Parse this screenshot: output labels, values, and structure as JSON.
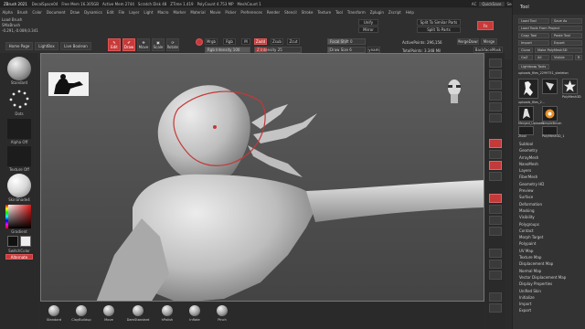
{
  "menubar": {
    "app_title": "ZBrush 2021",
    "stats": [
      "DecalSpace04",
      "Free Mem 16.305GB",
      "Active Mem 2744",
      "Scratch Disk 48",
      "ZTime 1.419",
      "Timer 0.001",
      "ATime 0.012",
      "PolyCount 4.753 MP",
      "MeshCount 1"
    ],
    "menus": [
      "Alpha",
      "Brush",
      "Color",
      "Document",
      "Draw",
      "Dynamics",
      "Edit",
      "File",
      "Layer",
      "Light",
      "Macro",
      "Marker",
      "Material",
      "Movie",
      "Picker",
      "Preferences",
      "Render",
      "Stencil",
      "Stroke",
      "Texture",
      "Tool",
      "Transform",
      "Zplugin",
      "Zscript",
      "Help"
    ],
    "right_items": [
      "AC",
      "QuickSave",
      "See-through 0",
      "Menus",
      "DefaultZScript"
    ]
  },
  "info": {
    "line1": "Load Brush",
    "line2": "SMaBrush",
    "coords": "-0.291,-0.089,0.341"
  },
  "toolbar": {
    "home_page": "Home Page",
    "lightbox": "LightBox",
    "live_boolean": "Live Boolean",
    "edit": "Edit",
    "draw": "Draw",
    "move": "Move",
    "scale": "Scale",
    "rotate": "Rotate",
    "mrgb": "Mrgb",
    "rgb": "Rgb",
    "m": "M",
    "zadd": "Zadd",
    "zsub": "Zsub",
    "zcut": "Zcut",
    "rgb_intensity": "Rgb Intensity 100",
    "z_intensity": "Z Intensity 25",
    "focal_shift": "Focal Shift 0",
    "draw_size": "Draw Size 6",
    "dynamic": "Dynamic",
    "active_points": "ActivePoints: 296,156",
    "total_points": "TotalPoints: 3.348 Mil",
    "merge_down": "MergeDown",
    "merge": "Merge",
    "backface_mask": "BackfaceMask",
    "unify": "Unify",
    "mirror": "Mirror",
    "split_services": "Split To Similar Parts",
    "split_parts": "Split To Parts",
    "fn_label": "Fn"
  },
  "leftshelf": {
    "standard": "Standard",
    "dots": "Dots",
    "alpha_off": "Alpha Off",
    "texture_off": "Texture Off",
    "skin_shade": "SkinShade4",
    "gradient": "Gradient",
    "switch_color": "SwitchColor",
    "alternate": "Alternate"
  },
  "rightpanel": {
    "header": "Tool",
    "load_tool": "Load Tool",
    "save_as": "Save As",
    "load_tools_from_project": "Load Tools From Project",
    "copy_tool": "Copy Tool",
    "paste_tool": "Paste Tool",
    "import": "Import",
    "export": "Export",
    "clone": "Clone",
    "make_polymesh": "Make PolyMesh3D",
    "goz": "GoZ",
    "all": "All",
    "visible": "Visible",
    "r": "R",
    "lightbox_tools": "Lightbox▸ Tools",
    "current_tool": "uploads_files_2299751_skeleton",
    "thumbs": [
      "uploads_files_2...",
      "PolyMesh3D",
      "Merged_Uploads",
      "SimpleBrush",
      "Ztool",
      "PolyMesh3D_1"
    ],
    "tool_list": [
      "Subtool",
      "Geometry",
      "ArrayMesh",
      "NanoMesh",
      "Layers",
      "FiberMesh",
      "Geometry HD",
      "Preview",
      "Surface",
      "Deformation",
      "Masking",
      "Visibility",
      "Polygroups",
      "Contact",
      "Morph Target",
      "Polypaint",
      "UV Map",
      "Texture Map",
      "Displacement Map",
      "Normal Map",
      "Vector Displacement Map",
      "Display Properties",
      "Unified Skin",
      "Initialize",
      "Import",
      "Export"
    ]
  },
  "bottombar": {
    "brushes": [
      "Standard",
      "ClayBuildup",
      "Move",
      "DamStandard",
      "hPolish",
      "Inflate",
      "Pinch"
    ]
  },
  "colors": {
    "accent_red": "#c83a3a",
    "panel_bg": "#333333",
    "viewport_bg": "#555555"
  }
}
